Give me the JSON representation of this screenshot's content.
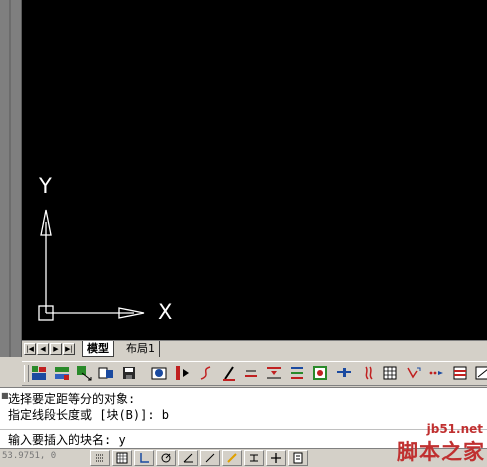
{
  "canvas": {
    "background": "#000000",
    "axis_color": "#ffffff",
    "ucs": {
      "x_label": "X",
      "y_label": "Y"
    }
  },
  "tabs": {
    "nav_buttons": [
      "first-tab",
      "prev-tab",
      "next-tab",
      "last-tab"
    ],
    "items": [
      {
        "label": "模型",
        "active": true
      },
      {
        "label": "布局1",
        "active": false
      }
    ]
  },
  "toolbar": {
    "icons": [
      "layer-icon",
      "layer-states-icon",
      "match-layer-icon",
      "save-layer-icon",
      "camera-icon",
      "mirror-icon",
      "curve-icon",
      "pen-icon",
      "dim-text-icon",
      "align-icon",
      "list-icon",
      "rectangle-icon",
      "faucet-icon",
      "wave-icon",
      "grid-icon",
      "move-icon",
      "dots-icon",
      "stack-icon",
      "arrow-icon"
    ]
  },
  "command": {
    "lines": [
      "选择要定距等分的对象:",
      "指定线段长度或 [块(B)]: b",
      "输入要插入的块名: y"
    ]
  },
  "status": {
    "coords": "53.9751, 0",
    "buttons": [
      "snap-icon",
      "grid-icon",
      "ortho-icon",
      "save-icon",
      "polar-icon",
      "osnap-icon",
      "otrack-icon",
      "lineweight-icon",
      "model-icon",
      "calculator-icon"
    ]
  },
  "watermark": {
    "url": "jb51.net",
    "name": "脚本之家"
  }
}
